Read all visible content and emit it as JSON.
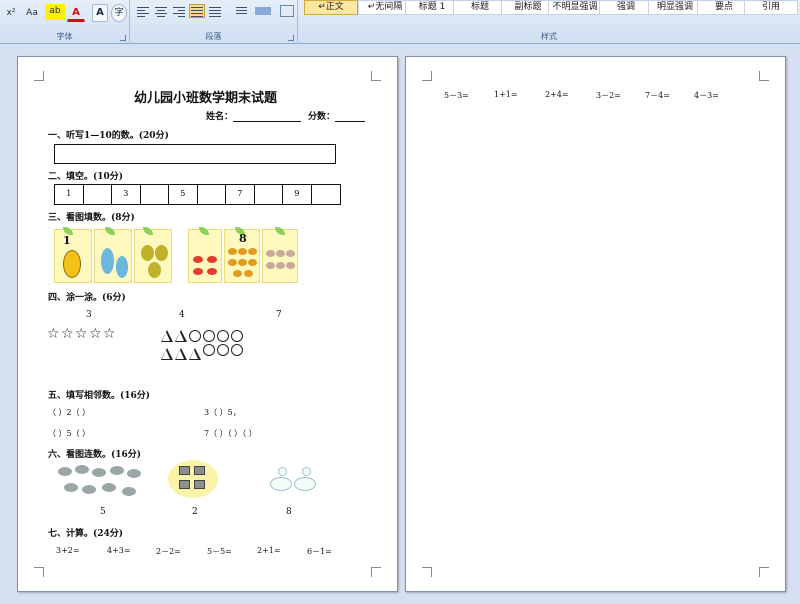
{
  "ribbon": {
    "font_group": {
      "label": "字体",
      "superscript": "x²",
      "font_size": "Aa",
      "highlight": "ab",
      "font_color": "A",
      "char_border": "A",
      "enclose": "字"
    },
    "paragraph_group": {
      "label": "段落"
    },
    "styles_group": {
      "label": "样式",
      "items": [
        "↵正文",
        "↵无间隔",
        "标题 1",
        "标题",
        "副标题",
        "不明显强调",
        "强调",
        "明显强调",
        "要点",
        "引用"
      ]
    }
  },
  "page1": {
    "title": "幼儿园小班数学期末试题",
    "name_label": "姓名：",
    "score_label": "分数：",
    "s1": "一、听写1—10的数。(20分)",
    "s2": "二、填空。(10分)",
    "fill_cells": [
      "1",
      "",
      "3",
      "",
      "5",
      "",
      "7",
      "",
      "9",
      ""
    ],
    "s3": "三、看图填数。(8分)",
    "card1_num": "1",
    "card2_num": "8",
    "s4": "四、涂一涂。(6分)",
    "color_nums": [
      "3",
      "4",
      "7"
    ],
    "s5": "五、填写相邻数。(16分)",
    "adj_row1_left": "（    ）2（    ）",
    "adj_row1_right": "3（    ）5，",
    "adj_row2_left": "（    ）5（    ）",
    "adj_row2_right": "7（    ）（    ）（    ）",
    "s6": "六、看图连数。(16分)",
    "link_nums": [
      "5",
      "2",
      "8"
    ],
    "s7": "七、计算。(24分)",
    "calc": [
      "3+2=",
      "4+3=",
      "2－2=",
      "5－5=",
      "2+1=",
      "6－1="
    ]
  },
  "page2": {
    "calc": [
      "5－3=",
      "1+1=",
      "2+4=",
      "3－2=",
      "7－4=",
      "4－3="
    ]
  },
  "colors": {
    "page_bg": "#ffffff",
    "workspace": "#d5e1f2",
    "ribbon_active": "#ffd98a"
  }
}
